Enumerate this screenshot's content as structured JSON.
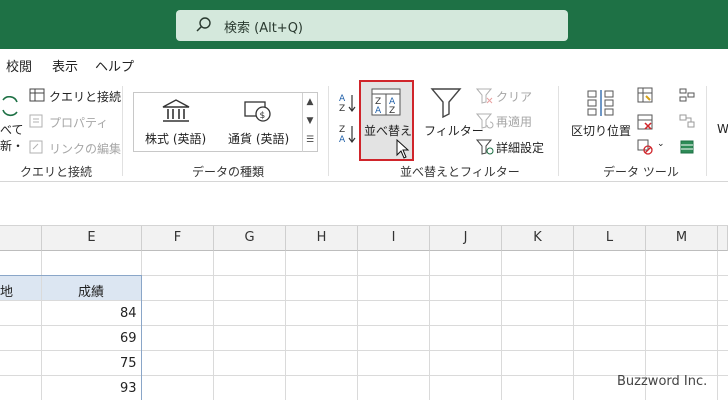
{
  "search": {
    "placeholder": "検索 (Alt+Q)"
  },
  "menubar": {
    "items": [
      "校閲",
      "表示",
      "ヘルプ"
    ]
  },
  "ribbon": {
    "query": {
      "partial_top": "べて",
      "partial_bottom": "新・",
      "queries_connections": "クエリと接続",
      "properties": "プロパティ",
      "edit_links": "リンクの編集",
      "group_label": "クエリと接続"
    },
    "datatypes": {
      "stocks": "株式 (英語)",
      "currencies": "通貨 (英語)",
      "group_label": "データの種類"
    },
    "sortfilter": {
      "sort": "並べ替え",
      "filter": "フィルター",
      "clear": "クリア",
      "reapply": "再適用",
      "advanced": "詳細設定",
      "group_label": "並べ替えとフィルター"
    },
    "tools": {
      "text_to_columns": "区切り位置",
      "group_label": "データ ツール",
      "partial_right": "W"
    }
  },
  "columns": [
    "E",
    "F",
    "G",
    "H",
    "I",
    "J",
    "K",
    "L",
    "M"
  ],
  "table": {
    "header_partial": "地",
    "header": "成績",
    "values": [
      "84",
      "69",
      "75",
      "93"
    ]
  },
  "watermark": "Buzzword Inc.",
  "colors": {
    "accent": "#1e7145",
    "highlight": "#d0252b",
    "header_fill": "#dce6f2"
  }
}
